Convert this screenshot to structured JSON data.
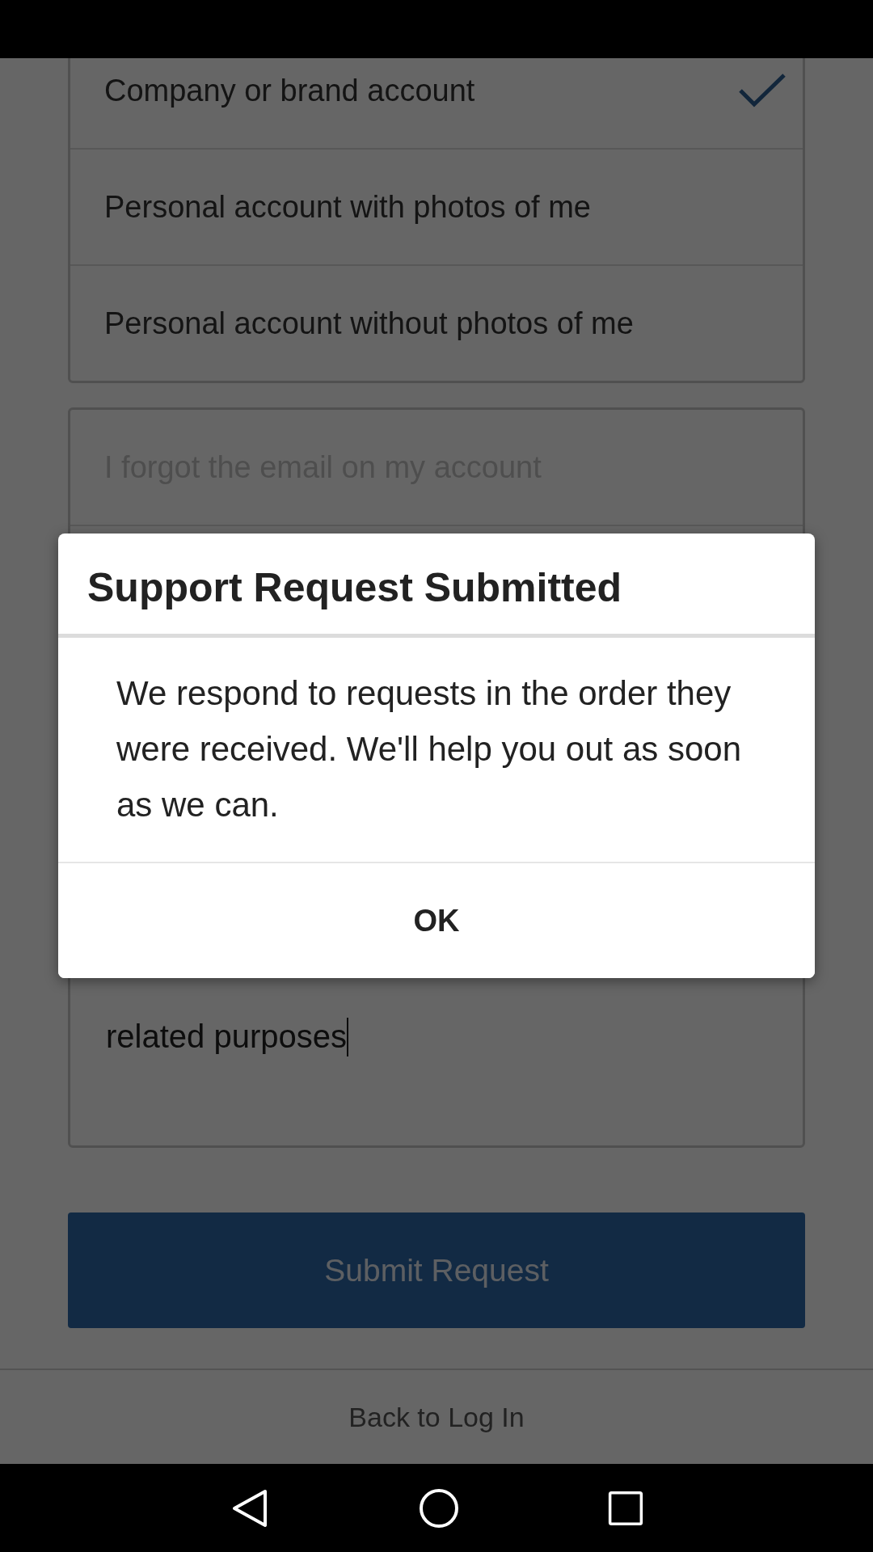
{
  "account_types": [
    {
      "label": "Company or brand account",
      "selected": true
    },
    {
      "label": "Personal account with photos of me",
      "selected": false
    },
    {
      "label": "Personal account without photos of me",
      "selected": false
    }
  ],
  "issue_options": [
    {
      "label": "I forgot the email on my account",
      "disabled": true
    }
  ],
  "message": {
    "value": "related purposes"
  },
  "submit_button": "Submit Request",
  "back_link": "Back to Log In",
  "dialog": {
    "title": "Support Request Submitted",
    "body": "We respond to requests in the order they were received. We'll help you out as soon as we can.",
    "button": "OK"
  }
}
